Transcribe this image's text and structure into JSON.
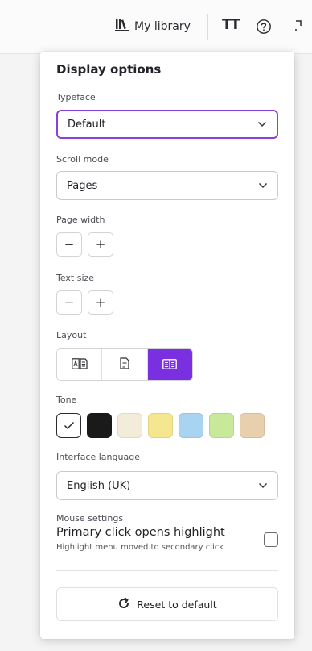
{
  "toolbar": {
    "library_label": "My library",
    "library_icon": "books-icon",
    "text_size_icon": "text-size-icon",
    "text_size_glyph": "TT",
    "help_icon": "help-circle-icon",
    "fullscreen_icon": "fullscreen-icon"
  },
  "panel": {
    "title": "Display options",
    "typeface": {
      "label": "Typeface",
      "value": "Default",
      "focused": true
    },
    "scroll_mode": {
      "label": "Scroll mode",
      "value": "Pages"
    },
    "page_width": {
      "label": "Page width",
      "decrease": "−",
      "increase": "+"
    },
    "text_size": {
      "label": "Text size",
      "decrease": "−",
      "increase": "+"
    },
    "layout": {
      "label": "Layout",
      "options": [
        {
          "icon": "translate-layout-icon",
          "active": false
        },
        {
          "icon": "single-page-icon",
          "active": false
        },
        {
          "icon": "two-column-icon",
          "active": true
        }
      ]
    },
    "tone": {
      "label": "Tone",
      "swatches": [
        "#ffffff",
        "#1a1a1a",
        "#f2ecd8",
        "#f5e690",
        "#a8d4f2",
        "#c8e89a",
        "#e8cfae"
      ],
      "selected_index": 0
    },
    "interface_language": {
      "label": "Interface language",
      "value": "English (UK)"
    },
    "mouse_settings": {
      "label": "Mouse settings",
      "primary": "Primary click opens highlight",
      "secondary": "Highlight menu moved to secondary click",
      "checked": false
    },
    "reset_label": "Reset to default"
  },
  "colors": {
    "accent": "#7a2fe0",
    "focus_border": "#8a3fe0"
  }
}
